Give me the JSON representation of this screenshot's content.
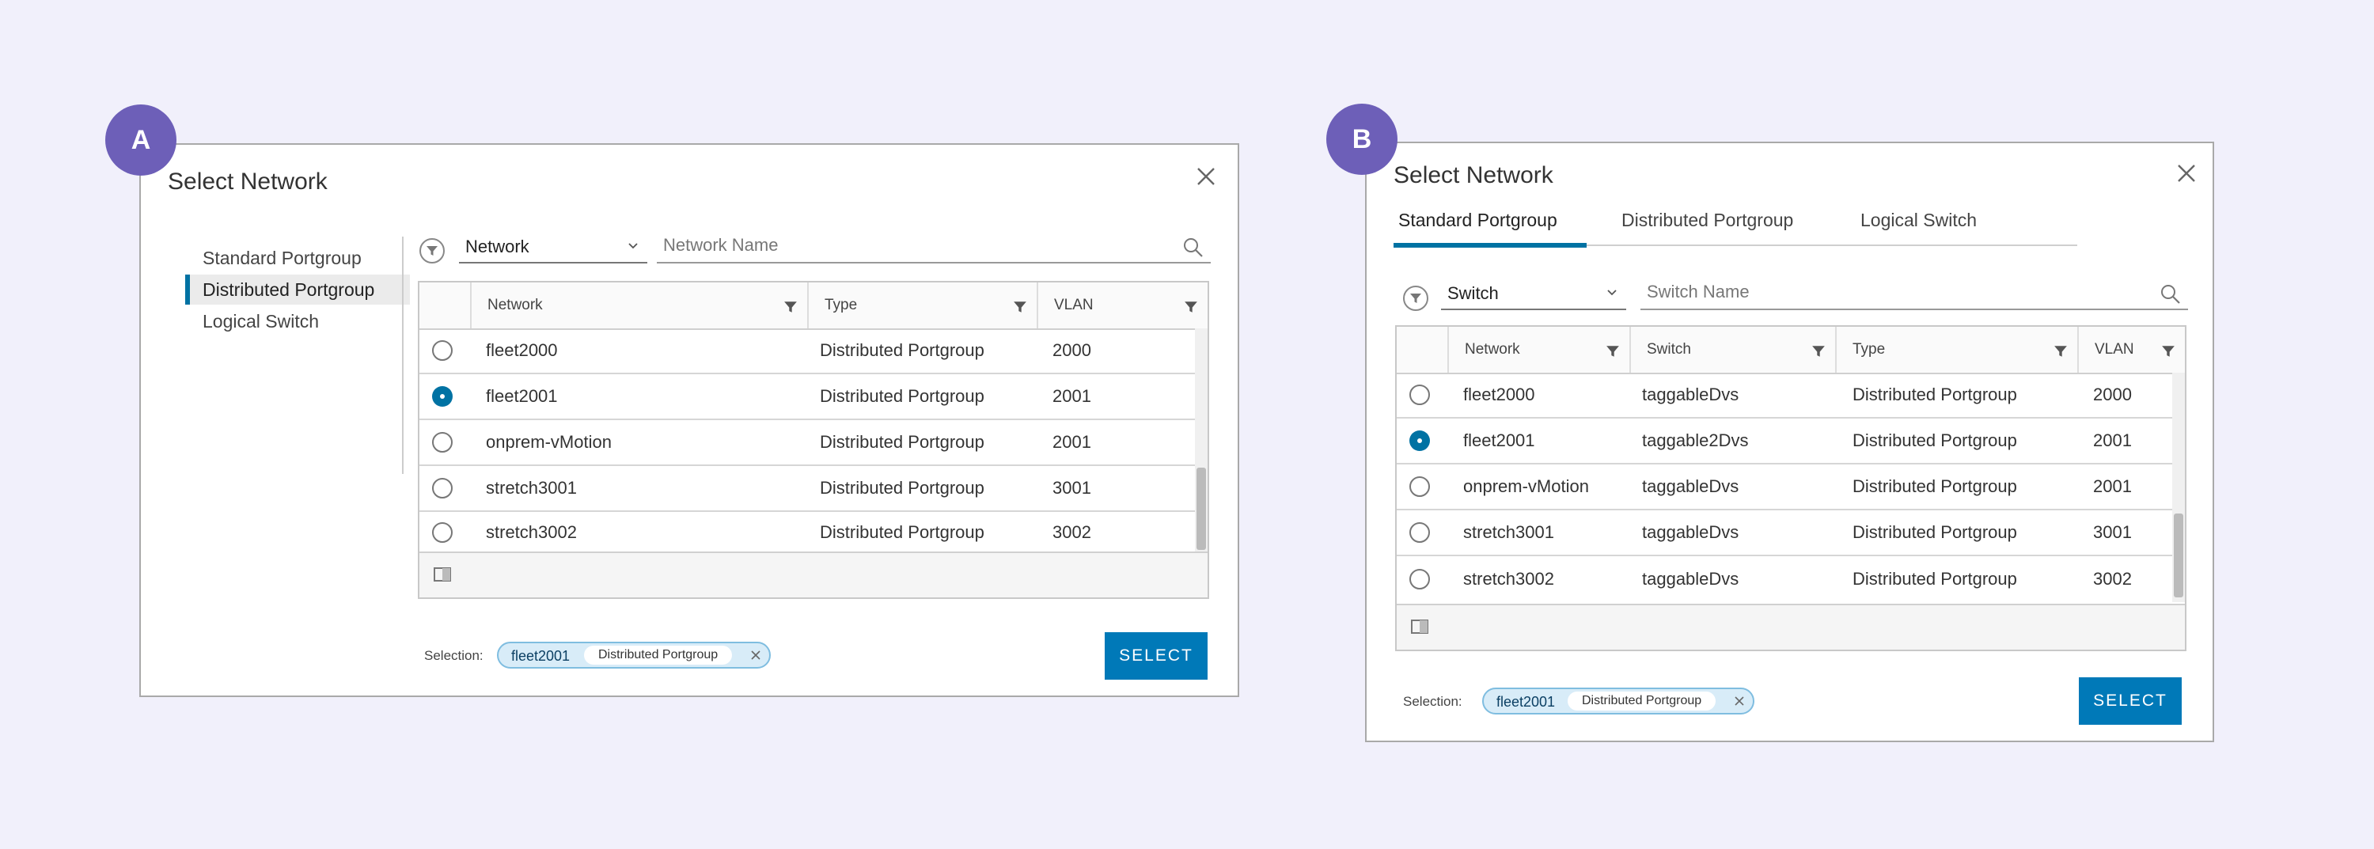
{
  "markers": {
    "a": "A",
    "b": "B"
  },
  "panel_a": {
    "title": "Select Network",
    "sidebar": [
      {
        "label": "Standard Portgroup",
        "active": false
      },
      {
        "label": "Distributed Portgroup",
        "active": true
      },
      {
        "label": "Logical Switch",
        "active": false
      }
    ],
    "filter": {
      "dropdown_value": "Network",
      "search_placeholder": "Network Name"
    },
    "columns": [
      "Network",
      "Type",
      "VLAN"
    ],
    "rows": [
      {
        "network": "fleet2000",
        "type": "Distributed Portgroup",
        "vlan": "2000",
        "selected": false
      },
      {
        "network": "fleet2001",
        "type": "Distributed Portgroup",
        "vlan": "2001",
        "selected": true
      },
      {
        "network": "onprem-vMotion",
        "type": "Distributed Portgroup",
        "vlan": "2001",
        "selected": false
      },
      {
        "network": "stretch3001",
        "type": "Distributed Portgroup",
        "vlan": "3001",
        "selected": false
      },
      {
        "network": "stretch3002",
        "type": "Distributed Portgroup",
        "vlan": "3002",
        "selected": false
      }
    ],
    "selection": {
      "label": "Selection:",
      "name": "fleet2001",
      "type": "Distributed Portgroup"
    },
    "select_button": "SELECT"
  },
  "panel_b": {
    "title": "Select Network",
    "tabs": [
      {
        "label": "Standard Portgroup",
        "active": true
      },
      {
        "label": "Distributed Portgroup",
        "active": false
      },
      {
        "label": "Logical Switch",
        "active": false
      }
    ],
    "filter": {
      "dropdown_value": "Switch",
      "search_placeholder": "Switch Name"
    },
    "columns": [
      "Network",
      "Switch",
      "Type",
      "VLAN"
    ],
    "rows": [
      {
        "network": "fleet2000",
        "switch": "taggableDvs",
        "type": "Distributed Portgroup",
        "vlan": "2000",
        "selected": false
      },
      {
        "network": "fleet2001",
        "switch": "taggable2Dvs",
        "type": "Distributed Portgroup",
        "vlan": "2001",
        "selected": true
      },
      {
        "network": "onprem-vMotion",
        "switch": "taggableDvs",
        "type": "Distributed Portgroup",
        "vlan": "2001",
        "selected": false
      },
      {
        "network": "stretch3001",
        "switch": "taggableDvs",
        "type": "Distributed Portgroup",
        "vlan": "3001",
        "selected": false
      },
      {
        "network": "stretch3002",
        "switch": "taggableDvs",
        "type": "Distributed Portgroup",
        "vlan": "3002",
        "selected": false
      }
    ],
    "selection": {
      "label": "Selection:",
      "name": "fleet2001",
      "type": "Distributed Portgroup"
    },
    "select_button": "SELECT"
  },
  "icons": {
    "close": "close-icon",
    "filter": "filter-icon",
    "chevron": "chevron-down-icon",
    "search": "search-icon",
    "columns": "column-toggle-icon",
    "remove": "chip-remove-icon"
  },
  "colors": {
    "accent": "#0072a3",
    "button": "#0079b8",
    "marker": "#6d5fb8",
    "background": "#f1f0fb"
  }
}
